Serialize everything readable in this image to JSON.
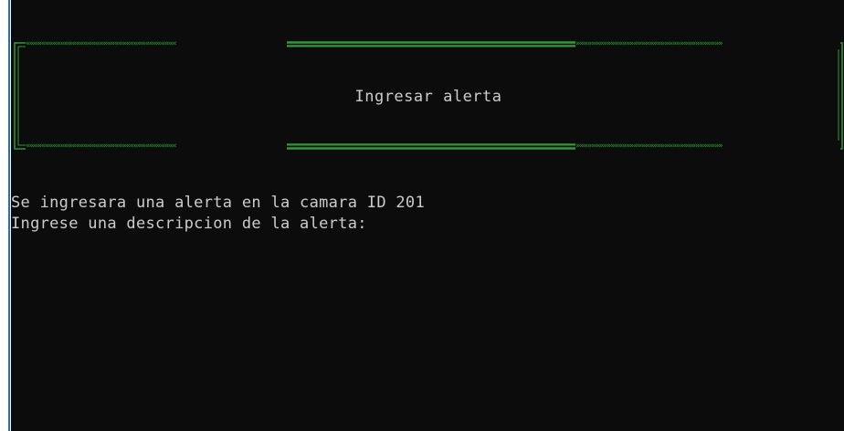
{
  "banner": {
    "title": "Ingresar alerta",
    "left_chevrons": "«««««««««««««««««««««««««««««««««««««««",
    "right_chevrons": "»»»»»»»»»»»»»»»»»»»»»»»»»»»»»»»»»»»»»»"
  },
  "output": {
    "line1": "Se ingresara una alerta en la camara ID 201",
    "line2": "Ingrese una descripcion de la alerta:"
  },
  "colors": {
    "background": "#0c0c0c",
    "text": "#cccccc",
    "border": "#2e9a38",
    "window_edge": "#1f6fd1"
  }
}
